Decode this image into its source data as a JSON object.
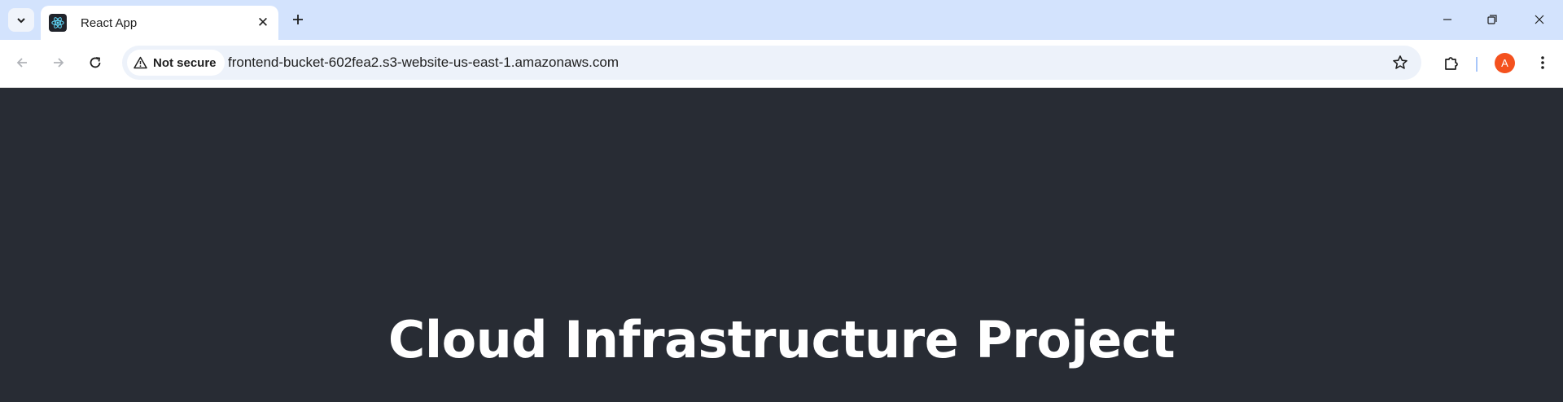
{
  "browser": {
    "tab": {
      "title": "React App",
      "favicon": "react-logo-icon"
    },
    "address_bar": {
      "security_label": "Not secure",
      "url": "frontend-bucket-602fea2.s3-website-us-east-1.amazonaws.com"
    },
    "profile": {
      "initial": "A",
      "color": "#f4511e"
    },
    "colors": {
      "tabstrip": "#d3e3fd",
      "omnibox": "#edf2fa"
    }
  },
  "page": {
    "heading": "Cloud Infrastructure Project",
    "background": "#282c34"
  }
}
